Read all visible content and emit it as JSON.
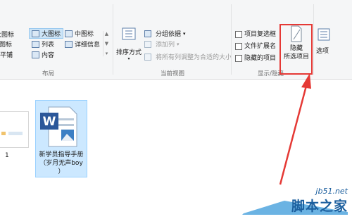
{
  "layout_group": {
    "items": [
      {
        "label": "超大图标",
        "visible": "超大图标"
      },
      {
        "label": "大图标"
      },
      {
        "label": "中图标"
      },
      {
        "label": "小图标"
      },
      {
        "label": "列表"
      },
      {
        "label": "详细信息"
      },
      {
        "label": "平铺"
      },
      {
        "label": "内容"
      }
    ],
    "group_label": "布局"
  },
  "current_view_group": {
    "sort_label": "排序方式",
    "group_by_label": "分组依据",
    "add_column_label": "添加列",
    "fit_columns_label": "将所有列调整为合适的大小",
    "group_label": "当前视图"
  },
  "show_hide_group": {
    "item_checkboxes_label": "项目复选框",
    "file_extensions_label": "文件扩展名",
    "hidden_items_label": "隐藏的项目",
    "hide_selected_line1": "隐藏",
    "hide_selected_line2": "所选项目",
    "group_label": "显示/隐藏"
  },
  "options_label": "选项",
  "files": {
    "partial_file_name": "1",
    "selected_file_name_line1": "新学员指导手册",
    "selected_file_name_line2": "（岁月无声boy",
    "selected_file_name_line3": "）"
  },
  "watermark": {
    "site": "jb51.net",
    "name": "脚本之家"
  },
  "colors": {
    "highlight": "#e53935",
    "selection": "#cce8ff",
    "word_blue": "#2b579a"
  }
}
